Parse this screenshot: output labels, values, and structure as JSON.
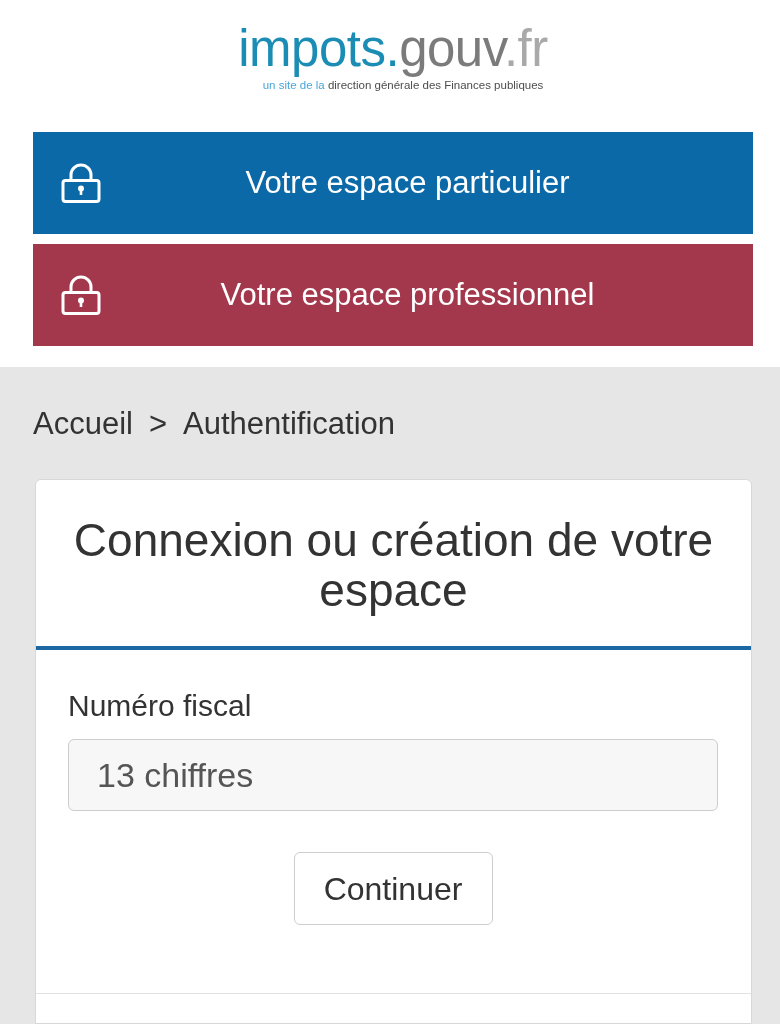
{
  "header": {
    "logo": [
      {
        "text": "impots.",
        "color": "#1b8db5"
      },
      {
        "text": "gouv",
        "color": "#7b7b7b"
      },
      {
        "text": ".fr",
        "color": "#a9a9a9"
      }
    ],
    "tagline": [
      {
        "text": "un site de la ",
        "color": "#4aa6d8"
      },
      {
        "text": "direction générale des Finances publiques",
        "color": "#4d4d4d"
      }
    ]
  },
  "spaces": [
    {
      "label": "Votre espace particulier",
      "color": "#0b69a7"
    },
    {
      "label": "Votre espace professionnel",
      "color": "#a3384d"
    }
  ],
  "breadcrumb": {
    "items": [
      {
        "label": "Accueil"
      },
      {
        "label": "Authentification"
      }
    ],
    "separator": ">"
  },
  "card": {
    "title": "Connexion ou création de votre espace",
    "field": {
      "label": "Numéro fiscal",
      "placeholder": "13 chiffres"
    },
    "button": "Continuer"
  }
}
